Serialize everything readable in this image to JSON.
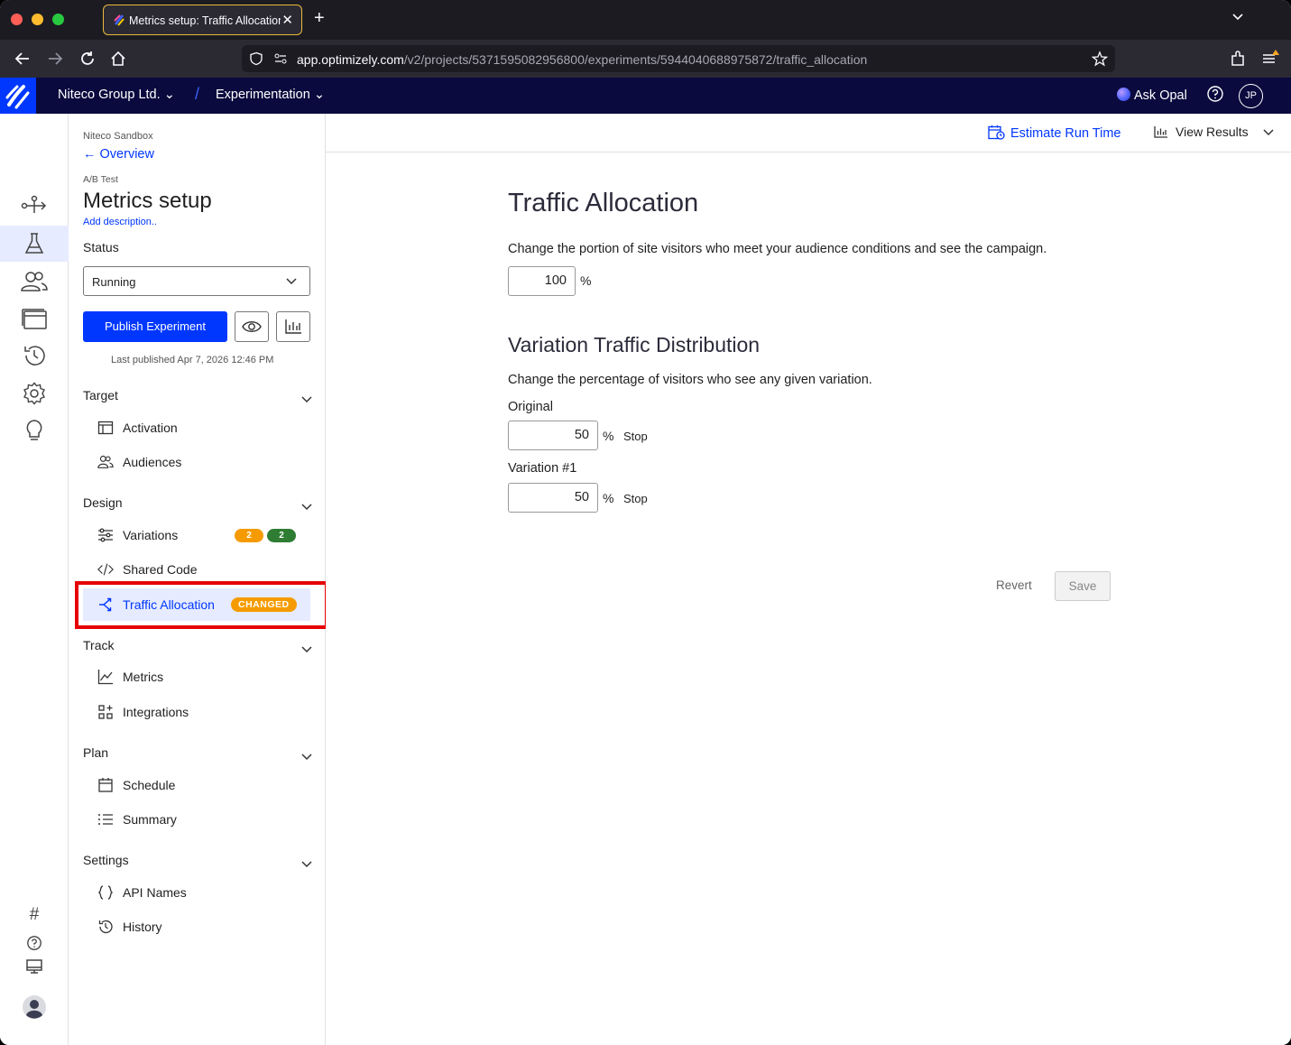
{
  "browser": {
    "tab_title": "Metrics setup: Traffic Allocation",
    "url_host": "app.optimizely.com",
    "url_path": "/v2/projects/5371595082956800/experiments/5944040688975872/traffic_allocation"
  },
  "header": {
    "org": "Niteco Group Ltd.",
    "project": "Experimentation",
    "ask_opal": "Ask Opal",
    "avatar_initials": "JP"
  },
  "sidebar": {
    "project_name": "Niteco Sandbox",
    "back_link": "Overview",
    "type": "A/B Test",
    "title": "Metrics setup",
    "add_description": "Add description..",
    "status_label": "Status",
    "status_value": "Running",
    "publish_button": "Publish Experiment",
    "last_published": "Last published Apr 7, 2026 12:46 PM",
    "sections": {
      "target": "Target",
      "design": "Design",
      "track": "Track",
      "plan": "Plan",
      "settings": "Settings"
    },
    "items": {
      "activation": "Activation",
      "audiences": "Audiences",
      "variations": "Variations",
      "variations_badge_a": "2",
      "variations_badge_b": "2",
      "shared_code": "Shared Code",
      "traffic_allocation": "Traffic Allocation",
      "changed_badge": "CHANGED",
      "metrics": "Metrics",
      "integrations": "Integrations",
      "schedule": "Schedule",
      "summary": "Summary",
      "api_names": "API Names",
      "history": "History"
    }
  },
  "topbar": {
    "estimate_run_time": "Estimate Run Time",
    "view_results": "View Results"
  },
  "main": {
    "title": "Traffic Allocation",
    "description": "Change the portion of site visitors who meet your audience conditions and see the campaign.",
    "allocation_value": "100",
    "percent": "%",
    "distribution_title": "Variation Traffic Distribution",
    "distribution_desc": "Change the percentage of visitors who see any given variation.",
    "variations": [
      {
        "name": "Original",
        "value": "50",
        "stop": "Stop"
      },
      {
        "name": "Variation #1",
        "value": "50",
        "stop": "Stop"
      }
    ],
    "revert": "Revert",
    "save": "Save"
  },
  "colors": {
    "brand": "#0037ff",
    "header_bg": "#0a0a3e",
    "changed": "#f59b00",
    "badge_green": "#2e7d32",
    "highlight": "#e60000"
  }
}
